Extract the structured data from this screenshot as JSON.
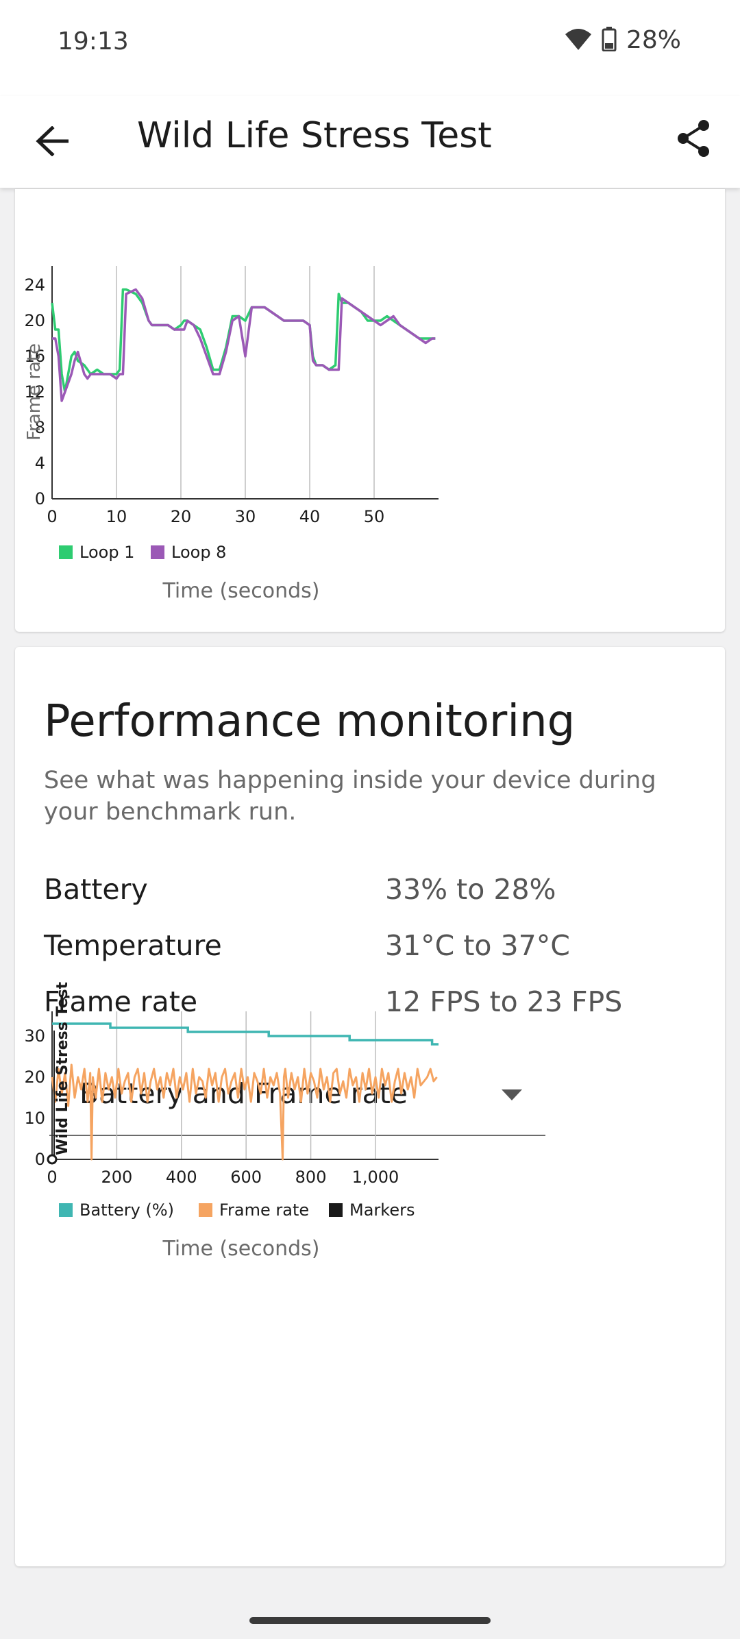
{
  "status_bar": {
    "time": "19:13",
    "battery_pct": "28%"
  },
  "app_bar": {
    "title": "Wild Life Stress Test",
    "back_icon": "arrow-back-icon",
    "share_icon": "share-icon"
  },
  "top_chart": {
    "chart_data": {
      "type": "line",
      "ylabel": "Frame rate",
      "xlabel": "Time (seconds)",
      "xlim": [
        0,
        60
      ],
      "ylim": [
        0,
        24
      ],
      "xticks": [
        "0",
        "10",
        "20",
        "30",
        "40",
        "50"
      ],
      "yticks": [
        "0",
        "4",
        "8",
        "12",
        "16",
        "20",
        "24"
      ],
      "grid": "vertical",
      "legend_position": "bottom-left",
      "series": [
        {
          "name": "Loop 1",
          "color": "#2ecc71",
          "x": [
            0,
            0.5,
            1,
            1.5,
            2,
            3,
            3.5,
            4,
            5,
            5.5,
            6,
            7,
            8,
            9,
            10,
            10.5,
            11,
            11.5,
            13,
            14,
            15,
            15.5,
            16,
            17,
            18,
            19,
            20,
            20.5,
            21,
            22,
            23,
            24,
            25,
            26,
            27,
            28,
            29,
            30,
            31,
            32,
            33,
            34,
            35,
            36,
            37,
            38,
            39,
            40,
            40.5,
            41,
            42,
            43,
            44,
            44.5,
            45,
            46,
            47,
            48,
            49,
            50,
            51,
            52,
            53,
            54,
            55,
            56,
            57,
            58,
            59,
            59.5
          ],
          "y": [
            22,
            19,
            19,
            14,
            12,
            16,
            16.5,
            15.5,
            15,
            14.5,
            14,
            14.5,
            14,
            14,
            14,
            14.5,
            23.5,
            23.5,
            23,
            22,
            20,
            19.5,
            19.5,
            19.5,
            19.5,
            19,
            19.5,
            20,
            20,
            19.5,
            19,
            17,
            14.5,
            14.5,
            17,
            20.5,
            20.5,
            20,
            21.5,
            21.5,
            21.5,
            21,
            20.5,
            20,
            20,
            20,
            20,
            19.5,
            16,
            15,
            15,
            14.5,
            15,
            23,
            22,
            22,
            21.5,
            21,
            20,
            20,
            20,
            20.5,
            20,
            19.5,
            19,
            18.5,
            18,
            18,
            18,
            18
          ]
        },
        {
          "name": "Loop 8",
          "color": "#9b59b6",
          "x": [
            0,
            0.5,
            1,
            1.5,
            2,
            3,
            3.5,
            4,
            5,
            5.5,
            6,
            7,
            8,
            9,
            10,
            10.5,
            11,
            11.5,
            13,
            14,
            15,
            15.5,
            16,
            17,
            18,
            19,
            20,
            20.5,
            21,
            22,
            23,
            24,
            25,
            26,
            27,
            28,
            29,
            30,
            31,
            32,
            33,
            34,
            35,
            36,
            37,
            38,
            39,
            40,
            40.5,
            41,
            42,
            43,
            44,
            44.5,
            45,
            46,
            47,
            48,
            49,
            50,
            51,
            52,
            53,
            54,
            55,
            56,
            57,
            58,
            59,
            59.5
          ],
          "y": [
            18,
            18,
            16,
            11,
            12,
            14,
            15.5,
            16.5,
            14,
            13.5,
            14,
            14,
            14,
            14,
            13.5,
            14,
            14,
            23,
            23.5,
            22.5,
            20,
            19.5,
            19.5,
            19.5,
            19.5,
            19,
            19,
            19,
            20,
            19.5,
            18,
            16,
            14,
            14,
            16.5,
            20,
            20.5,
            16,
            21.5,
            21.5,
            21.5,
            21,
            20.5,
            20,
            20,
            20,
            20,
            19.5,
            15.5,
            15,
            15,
            14.5,
            14.5,
            14.5,
            22.5,
            22,
            21.5,
            21,
            20.5,
            20,
            19.5,
            20,
            20.5,
            19.5,
            19,
            18.5,
            18,
            17.5,
            18,
            18
          ]
        }
      ]
    }
  },
  "perf": {
    "title": "Performance monitoring",
    "description": "See what was happening inside your device during your benchmark run.",
    "metrics": [
      {
        "label": "Battery",
        "value": "33% to 28%"
      },
      {
        "label": "Temperature",
        "value": "31°C to 37°C"
      },
      {
        "label": "Frame rate",
        "value": "12 FPS to 23 FPS"
      }
    ],
    "dropdown": {
      "value": "Battery and Frame rate",
      "icon": "dropdown-arrow-icon"
    }
  },
  "bottom_chart": {
    "chart_data": {
      "type": "line",
      "xlabel": "Time (seconds)",
      "xlim": [
        0,
        1195
      ],
      "ylim": [
        0,
        36
      ],
      "xticks": [
        "0",
        "200",
        "400",
        "600",
        "800",
        "1,000"
      ],
      "yticks": [
        "0",
        "10",
        "20",
        "30"
      ],
      "grid": "vertical",
      "legend_position": "bottom-left",
      "marker_label": "Wild Life Stress Test",
      "legend": [
        {
          "name": "Battery (%)",
          "color": "#3fb6b2"
        },
        {
          "name": "Frame rate",
          "color": "#f5a461"
        },
        {
          "name": "Markers",
          "color": "#1a1a1a"
        }
      ],
      "battery": {
        "x": [
          0,
          180,
          180,
          420,
          420,
          670,
          670,
          920,
          920,
          1175,
          1175,
          1195
        ],
        "y": [
          33,
          33,
          32,
          32,
          31,
          31,
          30,
          30,
          29,
          29,
          28,
          28
        ]
      },
      "framerate": {
        "x": [
          0,
          10,
          20,
          30,
          40,
          50,
          60,
          70,
          80,
          90,
          100,
          110,
          118,
          122,
          126,
          135,
          145,
          155,
          165,
          175,
          185,
          195,
          205,
          215,
          225,
          235,
          245,
          255,
          265,
          275,
          285,
          295,
          305,
          315,
          325,
          335,
          345,
          355,
          365,
          375,
          385,
          395,
          405,
          415,
          425,
          435,
          445,
          455,
          465,
          475,
          485,
          495,
          505,
          515,
          525,
          535,
          545,
          555,
          565,
          575,
          585,
          595,
          605,
          615,
          625,
          635,
          645,
          655,
          665,
          675,
          685,
          695,
          705,
          713,
          717,
          721,
          730,
          740,
          750,
          760,
          770,
          780,
          790,
          800,
          810,
          820,
          830,
          840,
          850,
          860,
          870,
          880,
          890,
          900,
          910,
          920,
          930,
          940,
          950,
          960,
          970,
          980,
          990,
          1000,
          1010,
          1020,
          1030,
          1040,
          1050,
          1060,
          1070,
          1080,
          1090,
          1100,
          1110,
          1120,
          1130,
          1140,
          1150,
          1160,
          1170,
          1180,
          1190
        ],
        "y": [
          20,
          14,
          22,
          16,
          21,
          13,
          23,
          15,
          20,
          17,
          22,
          14,
          21,
          0,
          20,
          15,
          22,
          14,
          21,
          17,
          20,
          15,
          22,
          16,
          19,
          21,
          14,
          20,
          22,
          16,
          21,
          14,
          19,
          22,
          17,
          20,
          15,
          21,
          18,
          22,
          15,
          20,
          17,
          21,
          14,
          22,
          16,
          20,
          19,
          15,
          22,
          18,
          21,
          14,
          20,
          22,
          16,
          19,
          21,
          15,
          22,
          17,
          20,
          14,
          21,
          19,
          16,
          22,
          15,
          20,
          18,
          21,
          16,
          0,
          20,
          22,
          15,
          21,
          17,
          20,
          14,
          22,
          16,
          21,
          19,
          15,
          22,
          17,
          20,
          14,
          21,
          22,
          16,
          19,
          15,
          22,
          18,
          20,
          14,
          21,
          17,
          22,
          16,
          20,
          15,
          22,
          18,
          21,
          14,
          19,
          22,
          16,
          21,
          17,
          20,
          15,
          22,
          18,
          19,
          20,
          22,
          19,
          20
        ]
      }
    }
  },
  "nav": {
    "handle": "gesture-nav-handle"
  }
}
